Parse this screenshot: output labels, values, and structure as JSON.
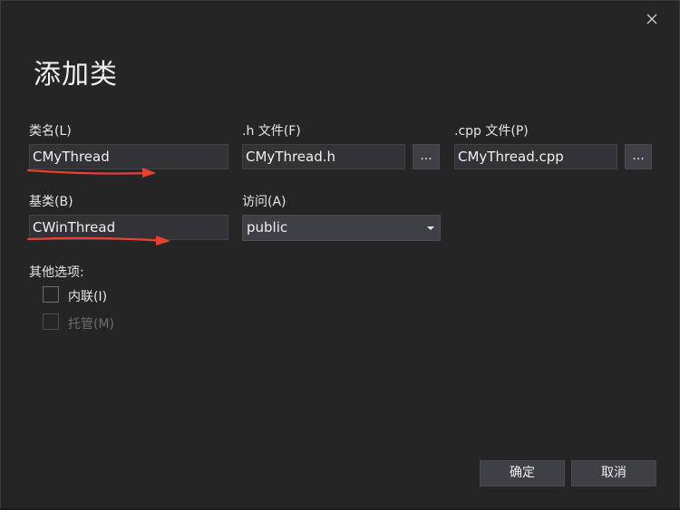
{
  "dialog": {
    "title": "添加类",
    "close_icon": "close-icon"
  },
  "class_name": {
    "label": "类名(L)",
    "value": "CMyThread"
  },
  "h_file": {
    "label": ".h 文件(F)",
    "value": "CMyThread.h",
    "browse_label": "..."
  },
  "cpp_file": {
    "label": ".cpp 文件(P)",
    "value": "CMyThread.cpp",
    "browse_label": "..."
  },
  "base_class": {
    "label": "基类(B)",
    "value": "CWinThread"
  },
  "access": {
    "label": "访问(A)",
    "selected": "public"
  },
  "other_options": {
    "label": "其他选项:",
    "inline_label": "内联(I)",
    "inline_checked": false,
    "managed_label": "托管(M)",
    "managed_checked": false,
    "managed_enabled": false
  },
  "buttons": {
    "ok_label": "确定",
    "cancel_label": "取消"
  },
  "colors": {
    "background": "#252526",
    "input_bg": "#333337",
    "button_bg": "#3f3f46",
    "annotation_arrow": "#e8412f"
  }
}
